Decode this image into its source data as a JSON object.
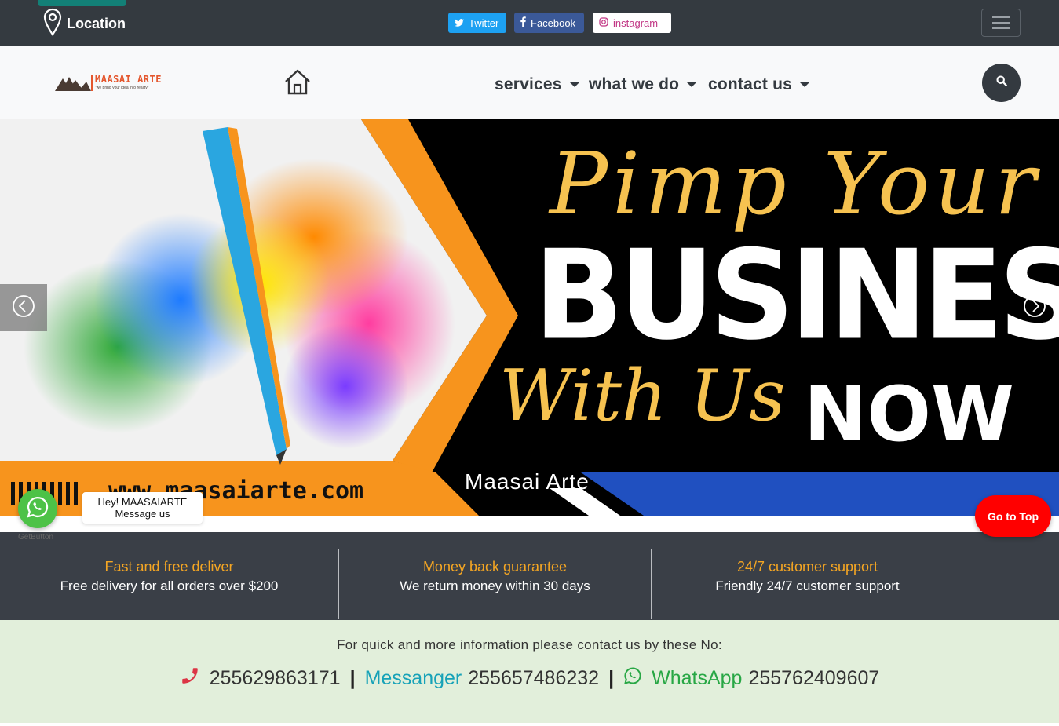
{
  "topbar": {
    "location_label": "Location",
    "social": [
      {
        "label": "Twitter",
        "icon": "twitter-icon"
      },
      {
        "label": "Facebook",
        "icon": "facebook-icon"
      },
      {
        "label": "instagram",
        "icon": "instagram-icon"
      }
    ]
  },
  "navbar": {
    "logo_text": "MAASAI ARTE",
    "logo_tagline": "\"we bring your idea into reality\"",
    "menu": [
      {
        "label": "services"
      },
      {
        "label": "what we do"
      },
      {
        "label": "contact us"
      }
    ]
  },
  "hero": {
    "script_line1": "Pimp Your",
    "headline": "BUSINESS",
    "script_line2": "With Us",
    "now": "NOW",
    "website": "www.maasaiarte.com",
    "caption": "Maasai Arte"
  },
  "features": [
    {
      "title": "Fast and free deliver",
      "desc": "Free delivery for all orders over $200"
    },
    {
      "title": "Money back guarantee",
      "desc": "We return money within 30 days"
    },
    {
      "title": "24/7 customer support",
      "desc": "Friendly 24/7 customer support"
    }
  ],
  "contact": {
    "text": "For quick and more information please contact us by these No:",
    "phone": "255629863171",
    "messenger_label": "Messanger",
    "messenger_no": "255657486232",
    "whatsapp_label": "WhatsApp",
    "whatsapp_no": "255762409607",
    "separator": "|"
  },
  "widgets": {
    "wa_label": "GetButton",
    "wa_bubble_line1": "Hey! MAASAIARTE",
    "wa_bubble_line2": "Message us",
    "go_to_top": "Go to Top"
  },
  "colors": {
    "dark": "#343a40",
    "accent_orange": "#f5a623",
    "whatsapp_green": "#28a745",
    "messenger_blue": "#17a2b8",
    "go_top_red": "#ff0000"
  }
}
